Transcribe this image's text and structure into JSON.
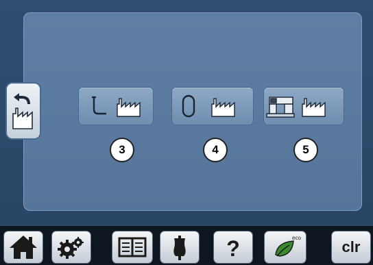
{
  "screen": {
    "back_button_icon": "return-arrow-factory-icon",
    "reset_options": [
      {
        "badge": "3",
        "icon": "presser-foot-factory-icon"
      },
      {
        "badge": "4",
        "icon": "hoop-factory-icon"
      },
      {
        "badge": "5",
        "icon": "machine-factory-icon"
      }
    ]
  },
  "toolbar": {
    "items": [
      {
        "icon": "home-icon"
      },
      {
        "icon": "setup-gears-icon"
      },
      {
        "icon": "tutorial-book-icon"
      },
      {
        "icon": "creative-consultant-dress-form-icon"
      },
      {
        "icon": "help-question-icon"
      },
      {
        "icon": "eco-leaf-icon",
        "text": "eco"
      },
      {
        "label": "clr"
      }
    ]
  }
}
